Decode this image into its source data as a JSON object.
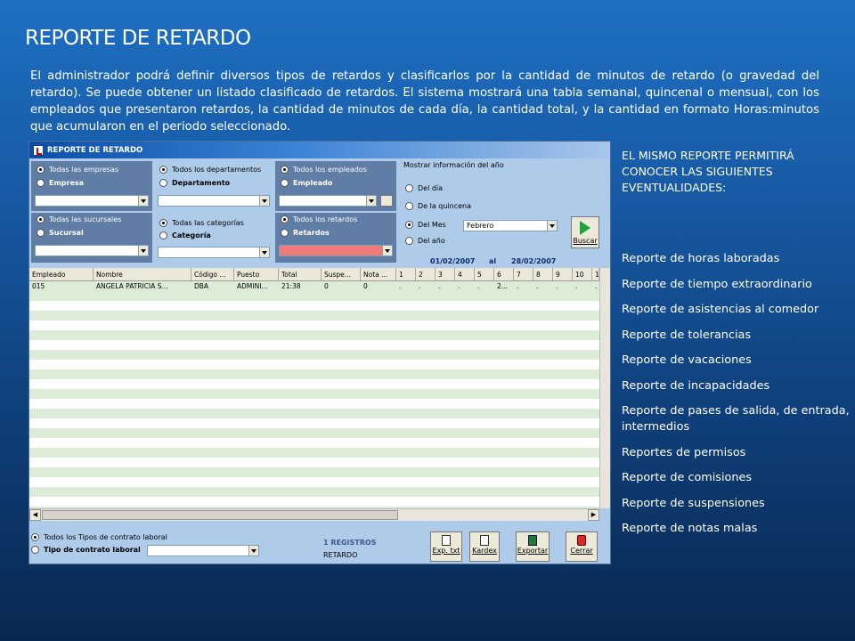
{
  "slide": {
    "title": "REPORTE DE RETARDO",
    "intro": "El administrador podrá definir diversos tipos de retardos y clasificarlos por la cantidad de minutos de retardo (o gravedad del retardo). Se puede obtener un listado clasificado de retardos. El sistema mostrará una tabla semanal, quincenal o mensual, con los empleados que presentaron retardos, la cantidad de minutos de cada día, la cantidad total, y la cantidad en formato Horas:minutos que acumularon en el periodo seleccionado.",
    "side_heading": "EL MISMO REPORTE PERMITIRÁ CONOCER LAS SIGUIENTES EVENTUALIDADES:",
    "side_items": [
      "Reporte de horas laboradas",
      "Reporte de tiempo extraordinario",
      "Reporte de asistencias al comedor",
      "Reporte de tolerancias",
      "Reporte de vacaciones",
      "Reporte de incapacidades",
      "Reporte de pases de salida, de entrada, intermedios",
      "Reportes de permisos",
      "Reporte de comisiones",
      "Reporte de suspensiones",
      "Reporte de notas malas"
    ]
  },
  "window": {
    "title": "REPORTE DE RETARDO",
    "filters": {
      "empresas_all": "Todas las empresas",
      "empresa": "Empresa",
      "sucursales_all": "Todas las sucursales",
      "sucursal": "Sucursal",
      "departamentos_all": "Todos los departamentos",
      "departamento": "Departamento",
      "categorias_all": "Todas las categorías",
      "categoria": "Categoría",
      "empleados_all": "Todos los empleados",
      "empleado": "Empleado",
      "retardos_all": "Todos los retardos",
      "retardos": "Retardos",
      "ellipsis": "..."
    },
    "period": {
      "heading": "Mostrar información del año",
      "options": [
        "Del día",
        "De la quincena",
        "Del Mes",
        "Del año"
      ],
      "month_value": "Febrero",
      "date_from": "01/02/2007",
      "al": "al",
      "date_to": "28/02/2007",
      "search_label": "Buscar"
    },
    "grid": {
      "columns": [
        "Empleado",
        "Nombre",
        "Código ...",
        "Puesto",
        "Total",
        "Suspe...",
        "Nota ...",
        "1",
        "2",
        "3",
        "4",
        "5",
        "6",
        "7",
        "8",
        "9",
        "10",
        "1"
      ],
      "rows": [
        [
          "015",
          "ANGELA PATRICIA S...",
          "DBA",
          "ADMINI...",
          "21:38",
          "0",
          "0",
          ".",
          ".",
          ".",
          ".",
          ".",
          "2...",
          ".",
          ".",
          ".",
          ".",
          "."
        ]
      ]
    },
    "footer": {
      "contract_all": "Todos los Tipos de contrato laboral",
      "contract_type": "Tipo de contrato laboral",
      "records": "1 REGISTROS",
      "report_name": "RETARDO",
      "buttons": [
        "Exp. txt",
        "Kardex",
        "Exportar",
        "Cerrar"
      ]
    }
  }
}
